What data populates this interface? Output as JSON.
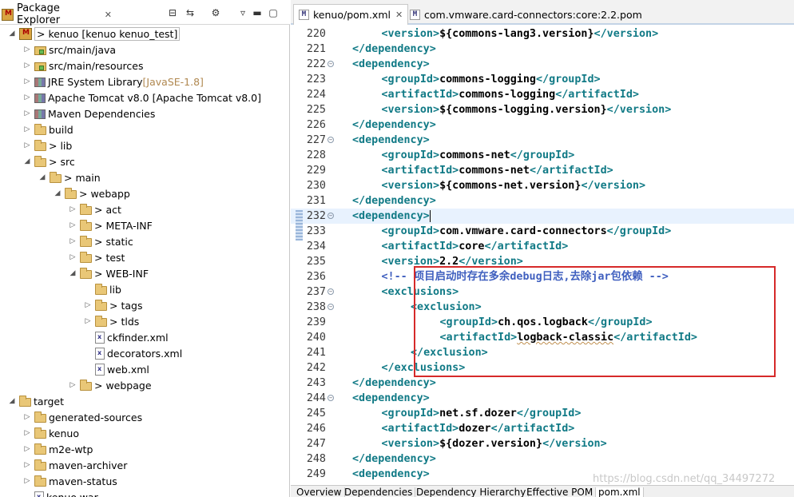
{
  "package_explorer": {
    "title": "Package Explorer",
    "tree": [
      {
        "label": "> kenuo [kenuo kenuo_test]",
        "icon": "project-icon",
        "twisty": "expanded",
        "depth": 0,
        "hl": true
      },
      {
        "label": "src/main/java",
        "icon": "package-folder-icon",
        "twisty": "collapsed",
        "depth": 1
      },
      {
        "label": "src/main/resources",
        "icon": "package-folder-icon",
        "twisty": "collapsed",
        "depth": 1
      },
      {
        "label": "JRE System Library",
        "suffix": "[JavaSE-1.8]",
        "icon": "library-icon",
        "twisty": "collapsed",
        "depth": 1
      },
      {
        "label": "Apache Tomcat v8.0 [Apache Tomcat v8.0]",
        "icon": "library-icon",
        "twisty": "collapsed",
        "depth": 1
      },
      {
        "label": "Maven Dependencies",
        "icon": "library-icon",
        "twisty": "collapsed",
        "depth": 1
      },
      {
        "label": "build",
        "icon": "folder-icon",
        "twisty": "collapsed",
        "depth": 1
      },
      {
        "label": "> lib",
        "icon": "folder-icon",
        "twisty": "collapsed",
        "depth": 1
      },
      {
        "label": "> src",
        "icon": "folder-icon",
        "twisty": "expanded",
        "depth": 1
      },
      {
        "label": "> main",
        "icon": "folder-icon",
        "twisty": "expanded",
        "depth": 2
      },
      {
        "label": "> webapp",
        "icon": "folder-icon",
        "twisty": "expanded",
        "depth": 3
      },
      {
        "label": "> act",
        "icon": "folder-icon",
        "twisty": "collapsed",
        "depth": 4
      },
      {
        "label": "> META-INF",
        "icon": "folder-icon",
        "twisty": "collapsed",
        "depth": 4
      },
      {
        "label": "> static",
        "icon": "folder-icon",
        "twisty": "collapsed",
        "depth": 4
      },
      {
        "label": "> test",
        "icon": "folder-icon",
        "twisty": "collapsed",
        "depth": 4
      },
      {
        "label": "> WEB-INF",
        "icon": "folder-icon",
        "twisty": "expanded",
        "depth": 4
      },
      {
        "label": "lib",
        "icon": "folder-icon",
        "twisty": "none",
        "depth": 5
      },
      {
        "label": "> tags",
        "icon": "folder-icon",
        "twisty": "collapsed",
        "depth": 5
      },
      {
        "label": "> tlds",
        "icon": "folder-icon",
        "twisty": "collapsed",
        "depth": 5
      },
      {
        "label": "ckfinder.xml",
        "icon": "xml-file-icon",
        "twisty": "none",
        "depth": 5
      },
      {
        "label": "decorators.xml",
        "icon": "xml-file-icon",
        "twisty": "none",
        "depth": 5
      },
      {
        "label": "web.xml",
        "icon": "xml-file-icon",
        "twisty": "none",
        "depth": 5
      },
      {
        "label": "> webpage",
        "icon": "folder-icon",
        "twisty": "collapsed",
        "depth": 4
      },
      {
        "label": "target",
        "icon": "folder-icon",
        "twisty": "expanded",
        "depth": 0
      },
      {
        "label": "generated-sources",
        "icon": "folder-icon",
        "twisty": "collapsed",
        "depth": 1
      },
      {
        "label": "kenuo",
        "icon": "folder-icon",
        "twisty": "collapsed",
        "depth": 1
      },
      {
        "label": "m2e-wtp",
        "icon": "folder-icon",
        "twisty": "collapsed",
        "depth": 1
      },
      {
        "label": "maven-archiver",
        "icon": "folder-icon",
        "twisty": "collapsed",
        "depth": 1
      },
      {
        "label": "maven-status",
        "icon": "folder-icon",
        "twisty": "collapsed",
        "depth": 1
      },
      {
        "label": "kenuo.war",
        "icon": "file-icon",
        "twisty": "none",
        "depth": 1
      }
    ]
  },
  "editor": {
    "tabs": [
      {
        "label": "kenuo/pom.xml",
        "active": true
      },
      {
        "label": "com.vmware.card-connectors:core:2.2.pom",
        "active": false
      }
    ],
    "lines": [
      {
        "n": "220",
        "indent": 3,
        "parts": [
          [
            "t",
            "<version>"
          ],
          [
            "b",
            "${commons-lang3.version}"
          ],
          [
            "t",
            "</version>"
          ]
        ]
      },
      {
        "n": "221",
        "indent": 2,
        "parts": [
          [
            "t",
            "</dependency>"
          ]
        ]
      },
      {
        "n": "222",
        "indent": 2,
        "fold": true,
        "parts": [
          [
            "t",
            "<dependency>"
          ]
        ]
      },
      {
        "n": "223",
        "indent": 3,
        "parts": [
          [
            "t",
            "<groupId>"
          ],
          [
            "b",
            "commons-logging"
          ],
          [
            "t",
            "</groupId>"
          ]
        ]
      },
      {
        "n": "224",
        "indent": 3,
        "parts": [
          [
            "t",
            "<artifactId>"
          ],
          [
            "b",
            "commons-logging"
          ],
          [
            "t",
            "</artifactId>"
          ]
        ]
      },
      {
        "n": "225",
        "indent": 3,
        "parts": [
          [
            "t",
            "<version>"
          ],
          [
            "b",
            "${commons-logging.version}"
          ],
          [
            "t",
            "</version>"
          ]
        ]
      },
      {
        "n": "226",
        "indent": 2,
        "parts": [
          [
            "t",
            "</dependency>"
          ]
        ]
      },
      {
        "n": "227",
        "indent": 2,
        "fold": true,
        "parts": [
          [
            "t",
            "<dependency>"
          ]
        ]
      },
      {
        "n": "228",
        "indent": 3,
        "parts": [
          [
            "t",
            "<groupId>"
          ],
          [
            "b",
            "commons-net"
          ],
          [
            "t",
            "</groupId>"
          ]
        ]
      },
      {
        "n": "229",
        "indent": 3,
        "parts": [
          [
            "t",
            "<artifactId>"
          ],
          [
            "b",
            "commons-net"
          ],
          [
            "t",
            "</artifactId>"
          ]
        ]
      },
      {
        "n": "230",
        "indent": 3,
        "parts": [
          [
            "t",
            "<version>"
          ],
          [
            "b",
            "${commons-net.version}"
          ],
          [
            "t",
            "</version>"
          ]
        ]
      },
      {
        "n": "231",
        "indent": 2,
        "parts": [
          [
            "t",
            "</dependency>"
          ]
        ]
      },
      {
        "n": "232",
        "indent": 2,
        "fold": true,
        "cur": true,
        "parts": [
          [
            "t",
            "<dependency>"
          ]
        ]
      },
      {
        "n": "233",
        "indent": 3,
        "parts": [
          [
            "t",
            "<groupId>"
          ],
          [
            "b",
            "com.vmware.card-connectors"
          ],
          [
            "t",
            "</groupId>"
          ]
        ]
      },
      {
        "n": "234",
        "indent": 3,
        "parts": [
          [
            "t",
            "<artifactId>"
          ],
          [
            "b",
            "core"
          ],
          [
            "t",
            "</artifactId>"
          ]
        ]
      },
      {
        "n": "235",
        "indent": 3,
        "parts": [
          [
            "t",
            "<version>"
          ],
          [
            "b",
            "2.2"
          ],
          [
            "t",
            "</version>"
          ]
        ]
      },
      {
        "n": "236",
        "indent": 3,
        "parts": [
          [
            "c",
            "<!-- 项目启动时存在多余debug日志,去除jar包依赖 -->"
          ]
        ]
      },
      {
        "n": "237",
        "indent": 3,
        "fold": true,
        "parts": [
          [
            "t",
            "<exclusions>"
          ]
        ]
      },
      {
        "n": "238",
        "indent": 4,
        "fold": true,
        "parts": [
          [
            "t",
            "<exclusion>"
          ]
        ]
      },
      {
        "n": "239",
        "indent": 5,
        "parts": [
          [
            "t",
            "<groupId>"
          ],
          [
            "b",
            "ch.qos.logback"
          ],
          [
            "t",
            "</groupId>"
          ]
        ]
      },
      {
        "n": "240",
        "indent": 5,
        "parts": [
          [
            "t",
            "<artifactId>"
          ],
          [
            "s",
            "logback-classic"
          ],
          [
            "t",
            "</artifactId>"
          ]
        ]
      },
      {
        "n": "241",
        "indent": 4,
        "parts": [
          [
            "t",
            "</exclusion>"
          ]
        ]
      },
      {
        "n": "242",
        "indent": 3,
        "parts": [
          [
            "t",
            "</exclusions>"
          ]
        ]
      },
      {
        "n": "243",
        "indent": 2,
        "parts": [
          [
            "t",
            "</dependency>"
          ]
        ]
      },
      {
        "n": "244",
        "indent": 2,
        "fold": true,
        "parts": [
          [
            "t",
            "<dependency>"
          ]
        ]
      },
      {
        "n": "245",
        "indent": 3,
        "parts": [
          [
            "t",
            "<groupId>"
          ],
          [
            "b",
            "net.sf.dozer"
          ],
          [
            "t",
            "</groupId>"
          ]
        ]
      },
      {
        "n": "246",
        "indent": 3,
        "parts": [
          [
            "t",
            "<artifactId>"
          ],
          [
            "b",
            "dozer"
          ],
          [
            "t",
            "</artifactId>"
          ]
        ]
      },
      {
        "n": "247",
        "indent": 3,
        "parts": [
          [
            "t",
            "<version>"
          ],
          [
            "b",
            "${dozer.version}"
          ],
          [
            "t",
            "</version>"
          ]
        ]
      },
      {
        "n": "248",
        "indent": 2,
        "parts": [
          [
            "t",
            "</dependency>"
          ]
        ]
      },
      {
        "n": "249",
        "indent": 2,
        "parts": [
          [
            "t",
            "<dependency>"
          ]
        ]
      }
    ],
    "bottom_tabs": [
      "Overview",
      "Dependencies",
      "Dependency Hierarchy",
      "Effective POM",
      "pom.xml"
    ],
    "active_bottom_tab": "pom.xml"
  },
  "watermark": "https://blog.csdn.net/qq_34497272",
  "colors": {
    "tag": "#117a86",
    "comment": "#3f5fbf",
    "highlight_box": "#d62a2a"
  }
}
